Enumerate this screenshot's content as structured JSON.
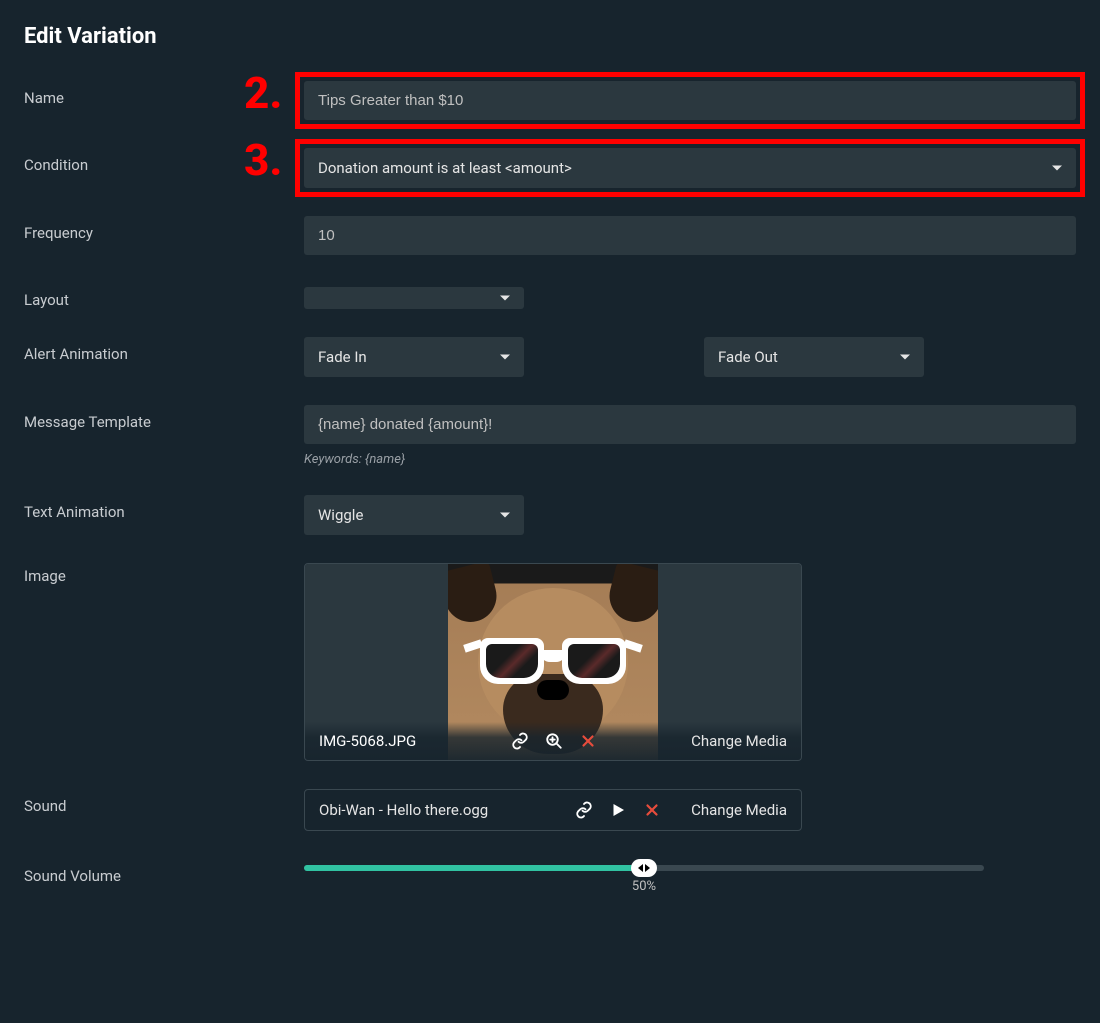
{
  "title": "Edit Variation",
  "annotations": {
    "step2": "2.",
    "step3": "3."
  },
  "fields": {
    "name": {
      "label": "Name",
      "value": "Tips Greater than $10"
    },
    "condition": {
      "label": "Condition",
      "value": "Donation amount is at least <amount>"
    },
    "frequency": {
      "label": "Frequency",
      "value": "10"
    },
    "layout": {
      "label": "Layout",
      "value": ""
    },
    "alert_animation": {
      "label": "Alert Animation",
      "in": "Fade In",
      "out": "Fade Out"
    },
    "message_template": {
      "label": "Message Template",
      "value": "{name} donated {amount}!",
      "hint": "Keywords: {name}"
    },
    "text_animation": {
      "label": "Text Animation",
      "value": "Wiggle"
    },
    "image": {
      "label": "Image",
      "filename": "IMG-5068.JPG",
      "change": "Change Media"
    },
    "sound": {
      "label": "Sound",
      "filename": "Obi-Wan - Hello there.ogg",
      "change": "Change Media"
    },
    "sound_volume": {
      "label": "Sound Volume",
      "percent_label": "50%",
      "percent": 50
    }
  }
}
